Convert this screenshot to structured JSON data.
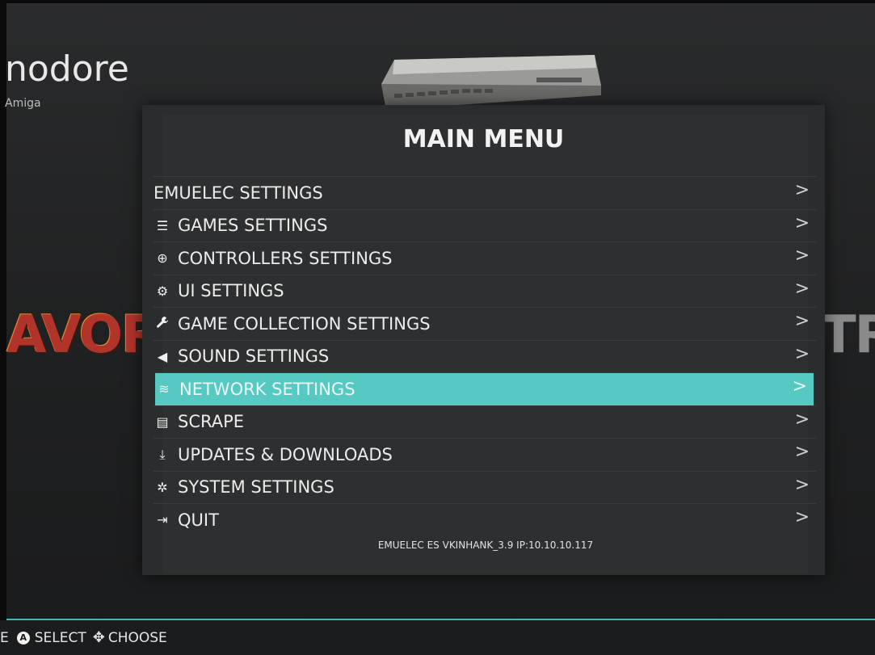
{
  "background": {
    "system_name": "nodore",
    "system_subtitle": "Amiga",
    "left_logo": "AVORI",
    "right_logo": "TRA"
  },
  "menu": {
    "title": "MAIN MENU",
    "items": [
      {
        "label": "EMUELEC SETTINGS",
        "icon": "",
        "icon_name": "none"
      },
      {
        "label": "GAMES SETTINGS",
        "icon": "☰",
        "icon_name": "sliders-icon"
      },
      {
        "label": "CONTROLLERS SETTINGS",
        "icon": "⊕",
        "icon_name": "gamepad-icon"
      },
      {
        "label": "UI SETTINGS",
        "icon": "⚙",
        "icon_name": "ui-gears-icon"
      },
      {
        "label": "GAME COLLECTION SETTINGS",
        "icon": "🔧",
        "icon_name": "wrench-icon"
      },
      {
        "label": "SOUND SETTINGS",
        "icon": "◀",
        "icon_name": "speaker-icon"
      },
      {
        "label": "NETWORK SETTINGS",
        "icon": "≋",
        "icon_name": "wifi-icon"
      },
      {
        "label": "SCRAPE",
        "icon": "▤",
        "icon_name": "scrape-icon"
      },
      {
        "label": "UPDATES & DOWNLOADS",
        "icon": "⤓",
        "icon_name": "download-icon"
      },
      {
        "label": "SYSTEM SETTINGS",
        "icon": "✲",
        "icon_name": "system-gears-icon"
      },
      {
        "label": "QUIT",
        "icon": "⇥",
        "icon_name": "quit-icon"
      }
    ],
    "selected_index": 6,
    "chevron": ">",
    "footer": "EMUELEC ES VKINHANK_3.9 IP:10.10.10.117"
  },
  "helpbar": {
    "leading": "E",
    "select_badge": "A",
    "select_label": "SELECT",
    "choose_label": "CHOOSE"
  },
  "colors": {
    "accent": "#56c9c3",
    "panel": "#2b2c2d",
    "text": "#ececec"
  }
}
